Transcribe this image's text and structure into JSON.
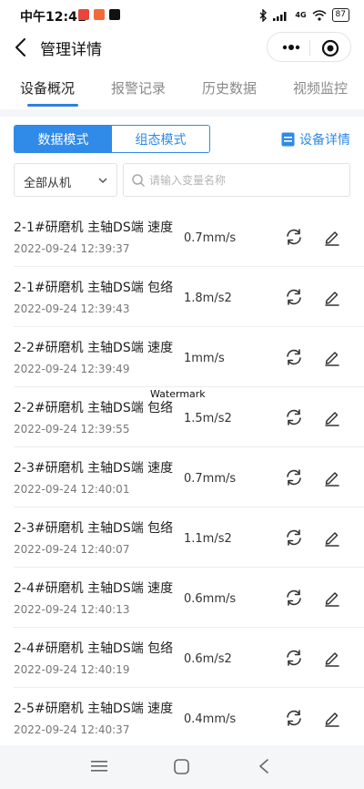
{
  "status_bar": {
    "time": "中午12:41",
    "network": "4G",
    "battery": "87"
  },
  "nav": {
    "title": "管理详情"
  },
  "tabs": [
    {
      "label": "设备概况",
      "active": true
    },
    {
      "label": "报警记录",
      "active": false
    },
    {
      "label": "历史数据",
      "active": false
    },
    {
      "label": "视频监控",
      "active": false
    }
  ],
  "mode": {
    "data_mode": "数据模式",
    "config_mode": "组态模式",
    "device_detail": "设备详情"
  },
  "filter": {
    "slave_select": "全部从机",
    "search_placeholder": "请输入变量名称"
  },
  "variables": [
    {
      "name": "2-1#研磨机 主轴DS端 速度",
      "time": "2022-09-24 12:39:37",
      "value": "0.7mm/s"
    },
    {
      "name": "2-1#研磨机 主轴DS端 包络",
      "time": "2022-09-24 12:39:43",
      "value": "1.8m/s2"
    },
    {
      "name": "2-2#研磨机 主轴DS端 速度",
      "time": "2022-09-24 12:39:49",
      "value": "1mm/s"
    },
    {
      "name": "2-2#研磨机 主轴DS端 包络",
      "time": "2022-09-24 12:39:55",
      "value": "1.5m/s2"
    },
    {
      "name": "2-3#研磨机 主轴DS端 速度",
      "time": "2022-09-24 12:40:01",
      "value": "0.7mm/s"
    },
    {
      "name": "2-3#研磨机 主轴DS端 包络",
      "time": "2022-09-24 12:40:07",
      "value": "1.1m/s2"
    },
    {
      "name": "2-4#研磨机 主轴DS端 速度",
      "time": "2022-09-24 12:40:13",
      "value": "0.6mm/s"
    },
    {
      "name": "2-4#研磨机 主轴DS端 包络",
      "time": "2022-09-24 12:40:19",
      "value": "0.6m/s2"
    },
    {
      "name": "2-5#研磨机 主轴DS端 速度",
      "time": "2022-09-24 12:40:37",
      "value": "0.4mm/s"
    }
  ],
  "watermark": "Watermark",
  "colors": {
    "accent": "#2f8ae8",
    "tab_underline": "#2f7fe0",
    "divider": "#ededed"
  }
}
